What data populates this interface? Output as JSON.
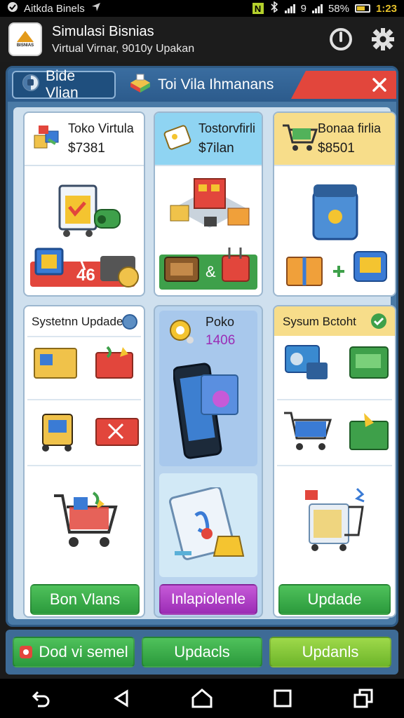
{
  "status_bar": {
    "app_label": "Aitkda Binels",
    "signal_1": "9",
    "signal_2": "58%",
    "time": "1:23",
    "icons": [
      "notification-icon",
      "location-icon",
      "n-badge-icon",
      "bluetooth-icon",
      "signal-icon",
      "battery-icon"
    ]
  },
  "header": {
    "title": "Simulasi Bisnias",
    "subtitle": "Virtual Virnar, 9010y Upakan",
    "logo_text": "BISNIAS",
    "icons": [
      "power-icon",
      "gear-icon"
    ]
  },
  "tabs": [
    {
      "label": "Bide Vlian",
      "icon": "globe-icon"
    },
    {
      "label": "Toi Vila Ihmanans",
      "icon": "box-icon"
    }
  ],
  "close_icon": "close-icon",
  "cards_top": [
    {
      "title": "Toko Virtula",
      "price": "$7381"
    },
    {
      "title": "Tostorvfirli",
      "price": "$7ilan"
    },
    {
      "title": "Bonaa firlia",
      "price": "$8501"
    }
  ],
  "cards_bottom": [
    {
      "title": "Systetnn Updade",
      "badge_icon": "circle-icon",
      "button": "Bon Vlans"
    },
    {
      "title": "Poko",
      "subtitle": "1406",
      "button": "Inlapiolenle"
    },
    {
      "title": "Sysum Bctoht",
      "badge_icon": "check-icon",
      "button": "Updade"
    }
  ],
  "card_a_badge": "46",
  "bottom_buttons": [
    "Dod vi semel",
    "Updacls",
    "Updanls"
  ],
  "nav": [
    "back-icon",
    "triangle-back-icon",
    "home-icon",
    "recents-icon",
    "multiwindow-icon"
  ],
  "colors": {
    "panel": "#4a7aa6",
    "tab_strip": "#e2463c",
    "green_button": "#2b9a3c",
    "purple_button": "#9b2cb5",
    "lime_button": "#8bc83a",
    "yellow_header": "#f7dd8a",
    "blue_header": "#8fd4f2"
  }
}
